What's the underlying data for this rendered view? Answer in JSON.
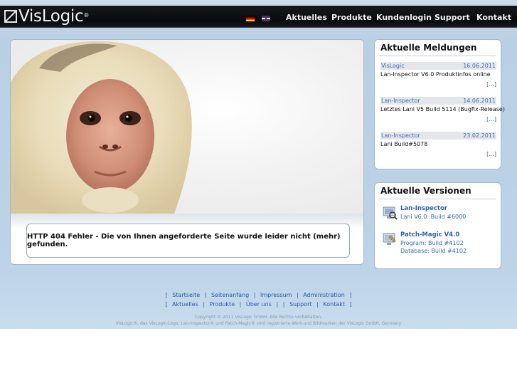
{
  "brand": {
    "logo_text": "VisLogic",
    "logo_mark": "®"
  },
  "languages": [
    {
      "code": "de",
      "icon": "german-flag-icon"
    },
    {
      "code": "en",
      "icon": "uk-flag-icon"
    }
  ],
  "nav": {
    "items": [
      {
        "label": "Aktuelles"
      },
      {
        "label": "Produkte"
      },
      {
        "label": "Kundenlogin"
      },
      {
        "label": "Support"
      },
      {
        "label": "Kontakt"
      }
    ]
  },
  "main": {
    "hero_icon": "capuchin-monkey-illustration",
    "error_message": "HTTP 404 Fehler - Die von Ihnen angeforderte Seite wurde leider nicht (mehr) gefunden."
  },
  "news": {
    "title": "Aktuelle Meldungen",
    "items": [
      {
        "category": "VisLogic",
        "date": "16.06.2011",
        "text": "Lan-Inspector V6.0 Produktinfos online",
        "more": "[...]"
      },
      {
        "category": "Lan-Inspector",
        "date": "14.06.2011",
        "text": "Letztes Lani V5 Build 5114 (Bugfix-Release)",
        "more": "[...]"
      },
      {
        "category": "Lan-Inspector",
        "date": "23.02.2011",
        "text": "Lani Build#5078",
        "more": "[...]"
      }
    ]
  },
  "versions": {
    "title": "Aktuelle Versionen",
    "items": [
      {
        "name": "Lan-Inspector",
        "lines": [
          "Lani V6.0: Build #6000"
        ],
        "icon": "lan-inspector-icon"
      },
      {
        "name": "Patch-Magic V4.0",
        "lines": [
          "Program: Build #4102",
          "Database: Build #4102"
        ],
        "icon": "patch-magic-icon"
      }
    ]
  },
  "footer": {
    "row1": [
      "[",
      "Startseite",
      "|",
      "Seitenanfang",
      "|",
      "Impressum",
      "|",
      "Administration",
      "]"
    ],
    "row2": [
      "[",
      "Aktuelles",
      "|",
      "Produkte",
      "|",
      "Über uns",
      "|",
      "|",
      "Support",
      "|",
      "Kontakt",
      "]"
    ],
    "copyright": "Copyright © 2011 VisLogic GmbH. Alle Rechte vorbehalten.",
    "trademark": "VisLogic®, das VisLogic-Logo, Lan-Inspector® und Patch-Magic® sind registrierte Wort-und Bildmarken der VisLogic GmbH, Germany"
  },
  "colors": {
    "link": "#3a6bb6",
    "header_bg": "#0f1113",
    "page_bg": "#c3d7ea"
  }
}
